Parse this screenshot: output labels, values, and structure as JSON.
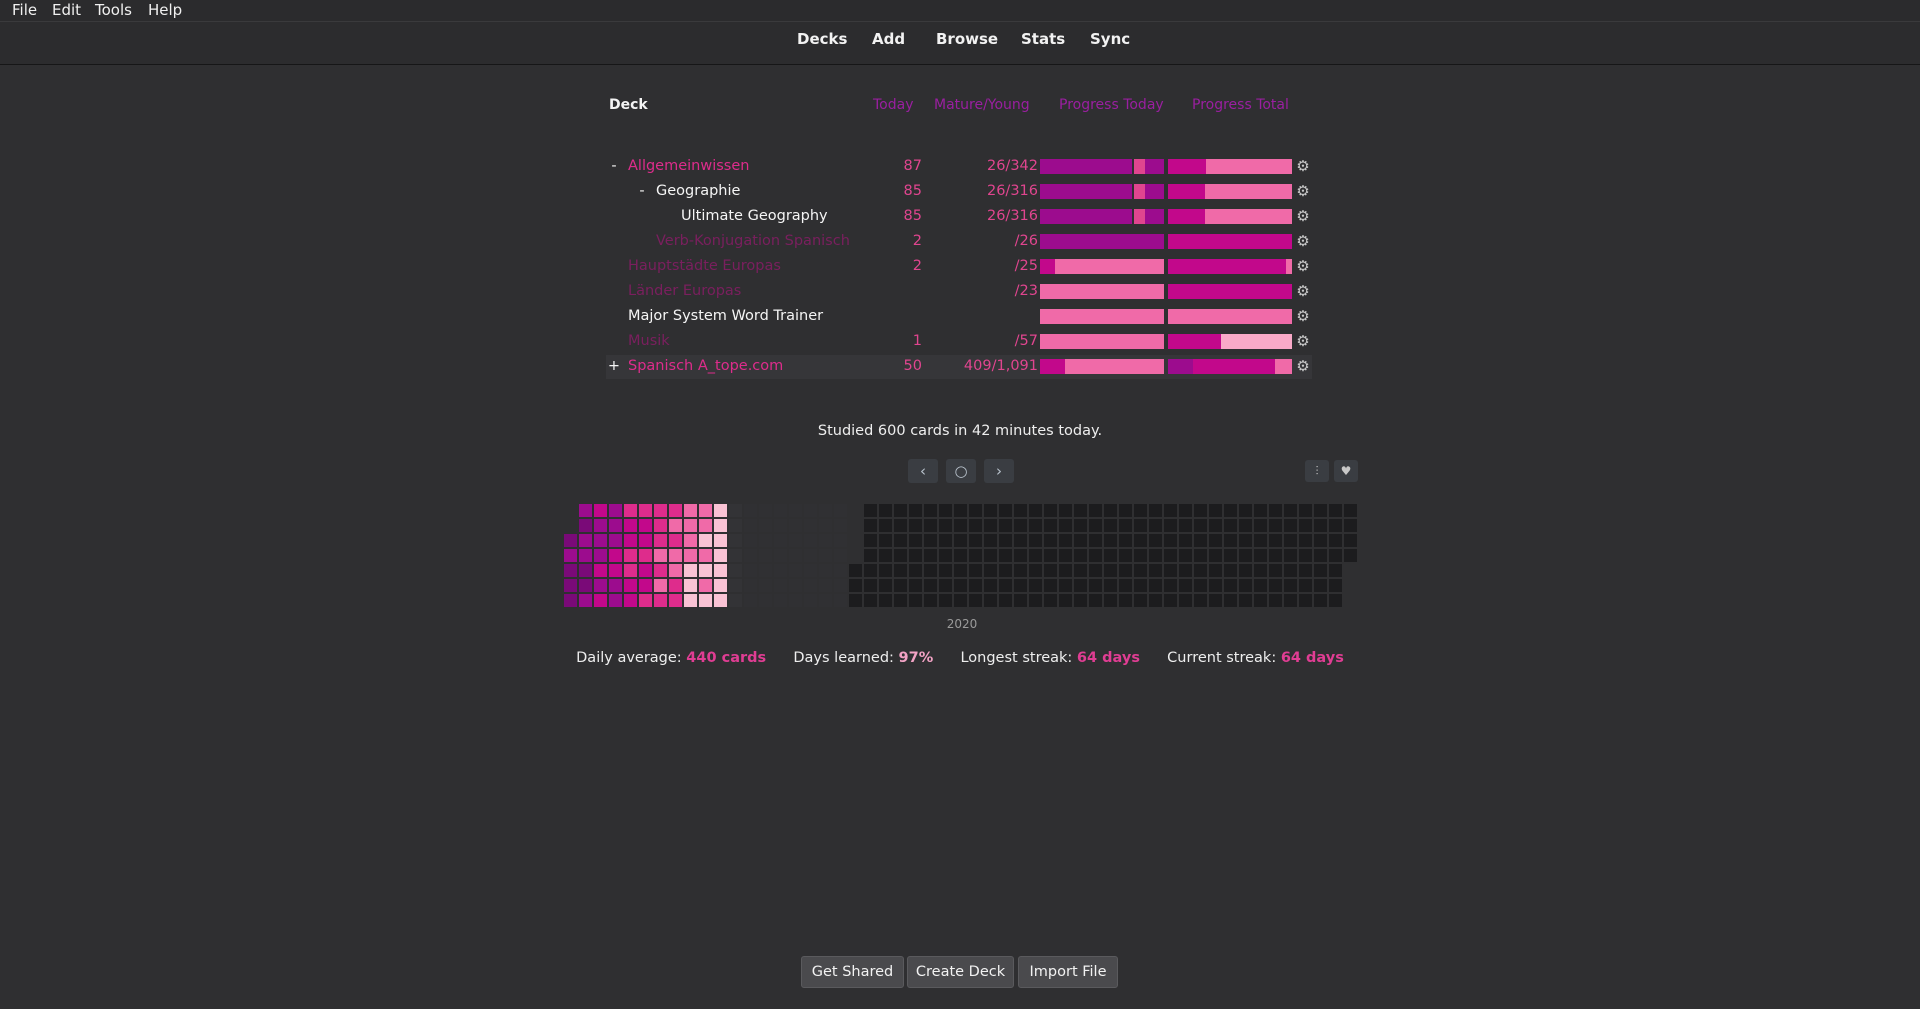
{
  "menu": [
    "File",
    "Edit",
    "Tools",
    "Help"
  ],
  "toolbar": [
    "Decks",
    "Add",
    "Browse",
    "Stats",
    "Sync"
  ],
  "table_headers": {
    "deck": "Deck",
    "today": "Today",
    "mature": "Mature/Young",
    "progress_today": "Progress Today",
    "progress_total": "Progress Total"
  },
  "decks": [
    {
      "collapse": "-",
      "name": "Allgemeinwissen",
      "today": "87",
      "mature": "26/342",
      "today_bar": 0.98,
      "total_bar": 0.31
    },
    {
      "collapse": "-",
      "name": "Geographie",
      "today": "85",
      "mature": "26/316",
      "today_bar": 0.98,
      "total_bar": 0.3
    },
    {
      "collapse": "",
      "name": "Ultimate Geography",
      "today": "85",
      "mature": "26/316",
      "today_bar": 0.98,
      "total_bar": 0.3
    },
    {
      "collapse": "",
      "name": "Verb-Konjugation Spanisch",
      "today": "2",
      "mature": "/26",
      "today_bar": 1.0,
      "total_bar": 1.0
    },
    {
      "collapse": "",
      "name": "Hauptstädte Europas",
      "today": "2",
      "mature": "/25",
      "today_bar": 0.12,
      "total_bar": 0.95
    },
    {
      "collapse": "",
      "name": "Länder Europas",
      "today": "",
      "mature": "/23",
      "today_bar": 0.0,
      "total_bar": 1.0
    },
    {
      "collapse": "",
      "name": "Major System Word Trainer",
      "today": "",
      "mature": "",
      "today_bar": 0.0,
      "total_bar": 0.0
    },
    {
      "collapse": "",
      "name": "Musik",
      "today": "1",
      "mature": "/57",
      "today_bar": 0.0,
      "total_bar": 0.43
    },
    {
      "collapse": "+",
      "name": "Spanisch A_tope.com",
      "today": "50",
      "mature": "409/1,091",
      "today_bar": 0.2,
      "total_bar": 0.86
    }
  ],
  "studied_text": "Studied 600 cards in 42 minutes today.",
  "heatmap_nav": {
    "prev": "‹",
    "today": "○",
    "next": "›"
  },
  "year_label": "2020",
  "stats": {
    "daily_average_label": "Daily average:",
    "daily_average_value": "440 cards",
    "days_learned_label": "Days learned:",
    "days_learned_value": "97%",
    "longest_streak_label": "Longest streak:",
    "longest_streak_value": "64 days",
    "current_streak_label": "Current streak:",
    "current_streak_value": "64 days"
  },
  "buttons": {
    "get_shared": "Get Shared",
    "create_deck": "Create Deck",
    "import_file": "Import File"
  },
  "colors": {
    "pink": "#de2c8c",
    "magenta": "#9c0c8e",
    "light_pink": "#f06aa8",
    "pale_pink": "#f9c2d4",
    "background": "#2f2f31"
  }
}
